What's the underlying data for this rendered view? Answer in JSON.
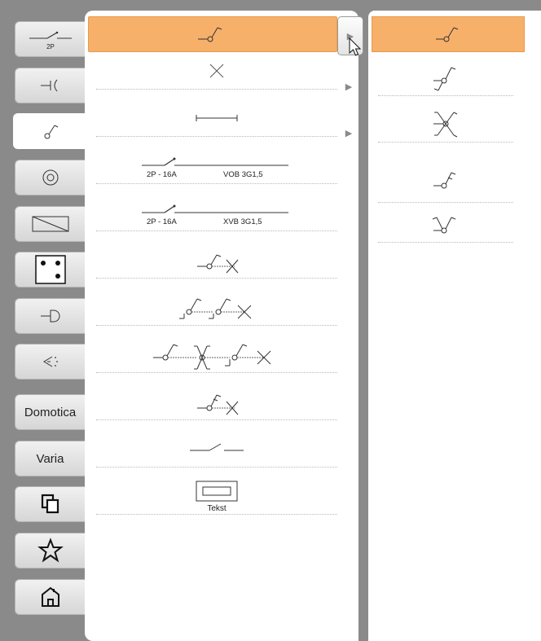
{
  "tabs": [
    {
      "name": "tab-schakelaar-2p",
      "icon": "switch-2p-icon",
      "label": "2P"
    },
    {
      "name": "tab-stopcontact",
      "icon": "socket-icon"
    },
    {
      "name": "tab-schakelaar",
      "icon": "switch-icon",
      "active": true
    },
    {
      "name": "tab-lichtpunt",
      "icon": "light-point-icon"
    },
    {
      "name": "tab-toestel",
      "icon": "appliance-icon"
    },
    {
      "name": "tab-aansluitdoos",
      "icon": "junction-box-icon"
    },
    {
      "name": "tab-drukknop",
      "icon": "push-button-icon"
    },
    {
      "name": "tab-detector",
      "icon": "detector-icon"
    },
    {
      "name": "tab-domotica",
      "label": "Domotica"
    },
    {
      "name": "tab-varia",
      "label": "Varia"
    },
    {
      "name": "tab-copy",
      "icon": "copy-icon"
    },
    {
      "name": "tab-favorites",
      "icon": "star-icon"
    },
    {
      "name": "tab-home",
      "icon": "home-icon"
    }
  ],
  "main_list": {
    "rows": [
      {
        "icon": "single-pole-switch-icon",
        "selected": true,
        "has_arrow": true
      },
      {
        "icon": "cross-icon",
        "has_arrow": true
      },
      {
        "icon": "line-icon",
        "has_arrow": true
      },
      {
        "icon": "circuit-breaker-icon",
        "left_label": "2P - 16A",
        "right_label": "VOB 3G1,5"
      },
      {
        "icon": "circuit-breaker-icon",
        "left_label": "2P - 16A",
        "right_label": "XVB 3G1,5"
      },
      {
        "icon": "switch-with-lamp-icon"
      },
      {
        "icon": "two-switches-lamp-icon"
      },
      {
        "icon": "three-switches-lamp-icon"
      },
      {
        "icon": "dimmer-switch-lamp-icon"
      },
      {
        "icon": "open-contact-icon"
      },
      {
        "icon": "text-box-icon",
        "label": "Tekst"
      }
    ]
  },
  "sub_list": {
    "rows": [
      {
        "icon": "single-pole-switch-icon",
        "selected": true
      },
      {
        "icon": "two-way-switch-icon"
      },
      {
        "icon": "intermediate-switch-icon"
      },
      {
        "icon": "dimmer-switch-icon"
      },
      {
        "icon": "double-switch-icon"
      }
    ]
  }
}
